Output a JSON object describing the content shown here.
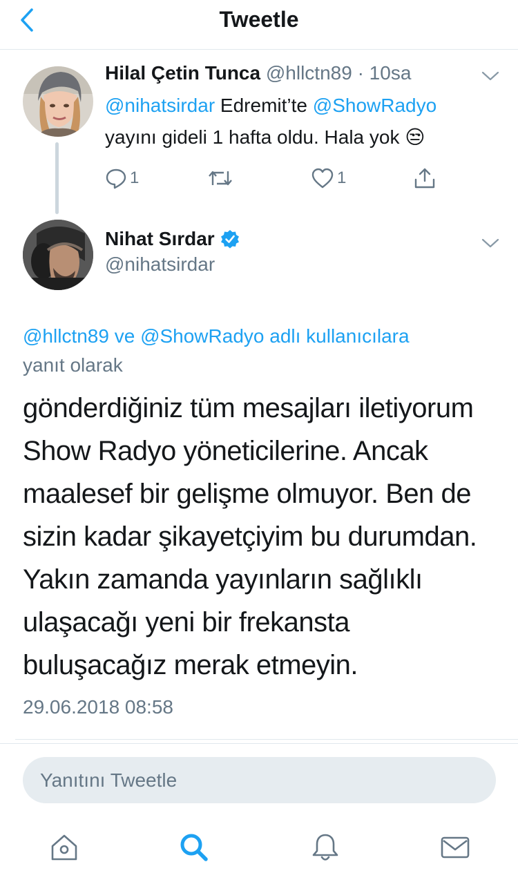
{
  "header": {
    "title": "Tweetle"
  },
  "reply_tweet": {
    "name": "Hilal Çetin Tunca",
    "handle": "@hllctn89",
    "time": "· 10sa",
    "mention1": "@nihatsirdar",
    "text1": " Edremit’te ",
    "mention2": "@ShowRadyo",
    "text2": "yayını gideli 1 hafta oldu. Hala yok 😒",
    "reply_count": "1",
    "like_count": "1"
  },
  "main_tweet": {
    "name": "Nihat Sırdar",
    "handle": "@nihatsirdar",
    "replying_links": "@hllctn89 ve @ShowRadyo adlı kullanıcılara",
    "replying_suffix": "yanıt olarak",
    "body": "gönderdiğiniz tüm mesajları iletiyorum Show Radyo yöneticilerine. Ancak maalesef bir gelişme olmuyor. Ben de sizin kadar şikayetçiyim bu durumdan. Yakın zamanda yayınların sağlıklı ulaşacağı yeni bir frekansta buluşacağız merak etmeyin.",
    "timestamp": "29.06.2018 08:58"
  },
  "composer": {
    "placeholder": "Yanıtını Tweetle"
  },
  "colors": {
    "accent": "#1da1f2",
    "secondary_text": "#657786",
    "border": "#e1e8ed"
  }
}
